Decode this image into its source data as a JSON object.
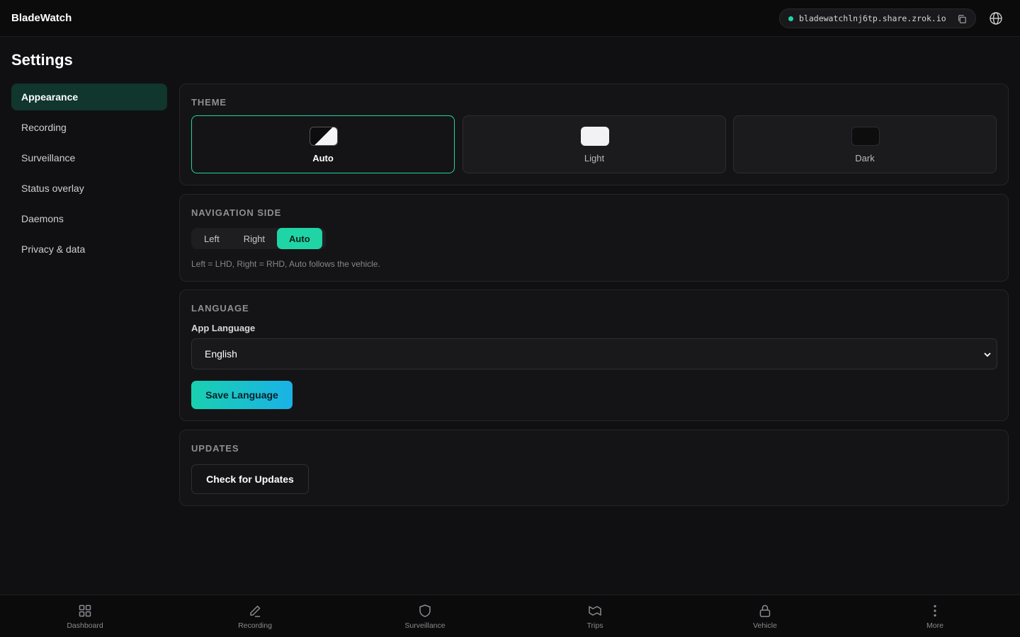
{
  "header": {
    "app_title": "BladeWatch",
    "share_url": "bladewatchlnj6tp.share.zrok.io",
    "status_color": "#1fd5a5",
    "icons": [
      "copy-icon",
      "globe-icon"
    ]
  },
  "page": {
    "title": "Settings"
  },
  "sidebar": {
    "items": [
      {
        "label": "Appearance",
        "active": true
      },
      {
        "label": "Recording"
      },
      {
        "label": "Surveillance"
      },
      {
        "label": "Status overlay"
      },
      {
        "label": "Daemons"
      },
      {
        "label": "Privacy & data"
      }
    ]
  },
  "theme": {
    "title": "THEME",
    "options": [
      {
        "label": "Auto",
        "selected": true
      },
      {
        "label": "Light"
      },
      {
        "label": "Dark"
      }
    ]
  },
  "navigation_side": {
    "title": "NAVIGATION SIDE",
    "options": [
      {
        "label": "Left"
      },
      {
        "label": "Right"
      },
      {
        "label": "Auto",
        "active": true
      }
    ],
    "hint": "Left = LHD, Right = RHD, Auto follows the vehicle."
  },
  "language": {
    "title": "LANGUAGE",
    "field_label": "App Language",
    "selected": "English",
    "save_label": "Save Language"
  },
  "updates": {
    "title": "UPDATES",
    "check_label": "Check for Updates"
  },
  "bottom_nav": {
    "items": [
      {
        "label": "Dashboard",
        "icon": "grid-icon"
      },
      {
        "label": "Recording",
        "icon": "pen-icon"
      },
      {
        "label": "Surveillance",
        "icon": "shield-icon"
      },
      {
        "label": "Trips",
        "icon": "map-icon"
      },
      {
        "label": "Vehicle",
        "icon": "lock-icon"
      },
      {
        "label": "More",
        "icon": "more-vertical-icon"
      }
    ]
  },
  "colors": {
    "accent": "#1fd5a5",
    "active_sidebar_bg": "#10362d",
    "background": "#101012"
  }
}
